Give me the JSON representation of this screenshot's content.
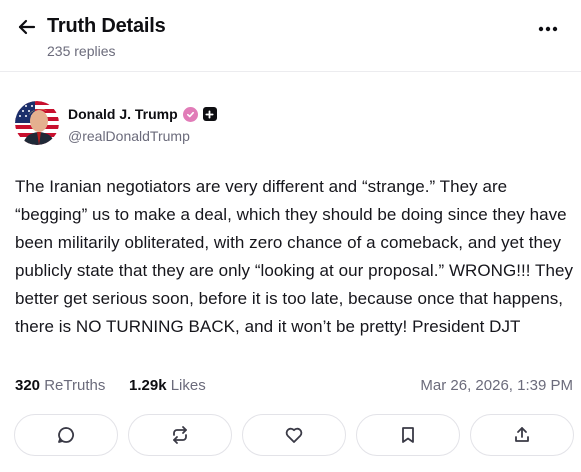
{
  "header": {
    "back_icon": "arrow-left-icon",
    "title": "Truth Details",
    "replies_count": "235 replies",
    "more_icon": "more-horizontal-icon"
  },
  "author": {
    "name": "Donald J. Trump",
    "handle": "@realDonaldTrump",
    "verified_badge_icon": "verified-check-icon",
    "plus_badge_icon": "plus-badge-icon",
    "verified_color": "#e17cb8"
  },
  "post": {
    "text": "The Iranian negotiators are very different and “strange.” They are “begging” us to make a deal, which they should be doing since they have been militarily obliterated, with zero chance of a comeback, and yet they publicly state that they are only “looking at our proposal.” WRONG!!! They better get serious soon, before it is too late, because once that happens, there is NO TURNING BACK, and it won’t be pretty! President DJT"
  },
  "stats": {
    "retruths_count": "320",
    "retruths_label": "ReTruths",
    "likes_count": "1.29k",
    "likes_label": "Likes",
    "timestamp": "Mar 26, 2026, 1:39 PM"
  },
  "actions": [
    {
      "icon": "reply-icon"
    },
    {
      "icon": "retruth-icon"
    },
    {
      "icon": "heart-icon"
    },
    {
      "icon": "bookmark-icon"
    },
    {
      "icon": "share-icon"
    }
  ]
}
